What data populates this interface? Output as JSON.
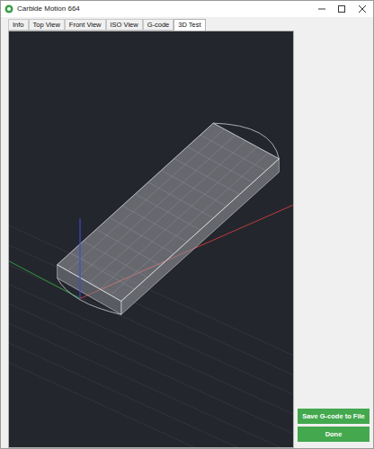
{
  "window": {
    "title": "Carbide Motion 664"
  },
  "tabs": [
    {
      "label": "Info",
      "selected": false
    },
    {
      "label": "Top View",
      "selected": false
    },
    {
      "label": "Front View",
      "selected": false
    },
    {
      "label": "ISO View",
      "selected": false
    },
    {
      "label": "G-code",
      "selected": false
    },
    {
      "label": "3D Test",
      "selected": true
    }
  ],
  "buttons": [
    {
      "label": "Save G-code to File"
    },
    {
      "label": "Done"
    }
  ]
}
